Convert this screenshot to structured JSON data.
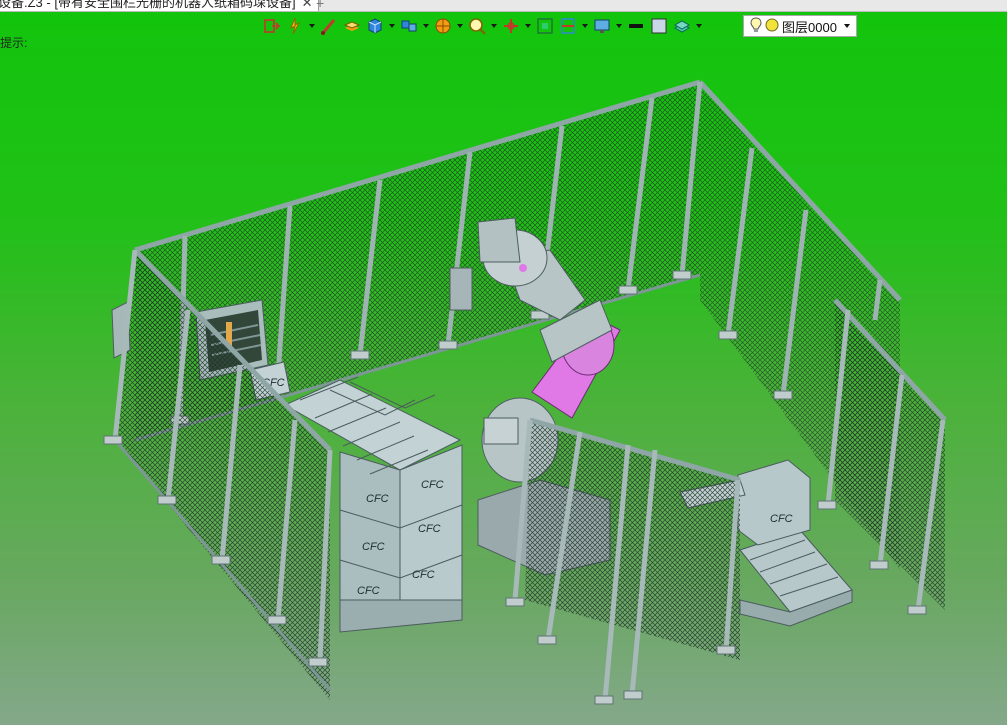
{
  "window": {
    "tab_title": "设备.Z3 - [带有安全围栏光栅的机器人纸箱码垛设备]",
    "close_glyph": "✕",
    "new_tab_glyph": "+"
  },
  "viewport": {
    "hint": "提示:",
    "box_label": "CFC"
  },
  "toolbar": {
    "buttons": [
      {
        "name": "exit-sketch-icon",
        "dropdown": false
      },
      {
        "name": "light-icon",
        "dropdown": true
      },
      {
        "name": "brush-icon",
        "dropdown": false
      },
      {
        "name": "stack-icon",
        "dropdown": false
      },
      {
        "name": "cube-icon",
        "dropdown": true
      },
      {
        "name": "multi-cube-icon",
        "dropdown": true
      },
      {
        "name": "ball-icon",
        "dropdown": true
      },
      {
        "name": "zoom-icon",
        "dropdown": true
      },
      {
        "name": "pan-icon",
        "dropdown": true
      },
      {
        "name": "fit-view-icon",
        "dropdown": false
      },
      {
        "name": "section-icon",
        "dropdown": true
      },
      {
        "name": "display-icon",
        "dropdown": true
      },
      {
        "name": "line-color-icon",
        "dropdown": false
      },
      {
        "name": "fill-color-icon",
        "dropdown": false
      },
      {
        "name": "layer-stack-icon",
        "dropdown": true
      }
    ],
    "layer": {
      "icons": [
        "bulb-icon",
        "circle-icon"
      ],
      "value": "图层0000"
    }
  },
  "colors": {
    "background_top": "#12c40c",
    "background_bottom": "#84a88a",
    "fence_frame": "#8fa6a6",
    "mesh": "#1f3327",
    "robot_pink": "#e079e6",
    "robot_grey": "#b7c5c7",
    "carton": "#b4c7c9"
  }
}
